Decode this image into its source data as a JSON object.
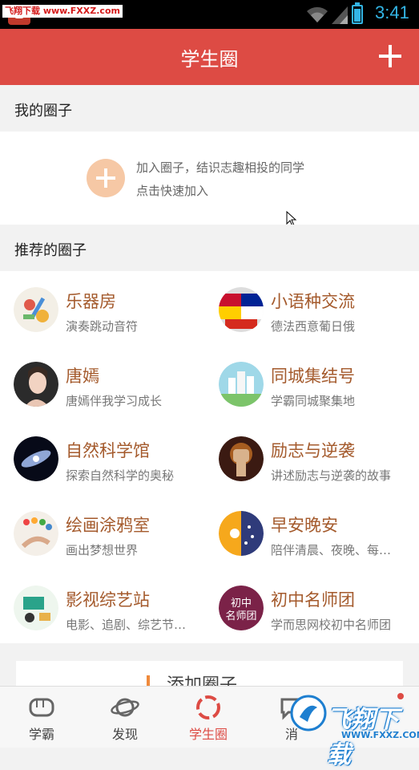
{
  "statusbar": {
    "watermark": "飞翔下载 www.FXXZ.com",
    "time": "3:41"
  },
  "header": {
    "title": "学生圈",
    "add_icon": "plus-icon"
  },
  "my_circles": {
    "heading": "我的圈子",
    "join_line1": "加入圈子，结识志趣相投的同学",
    "join_line2": "点击快速加入"
  },
  "recommended": {
    "heading": "推荐的圈子",
    "items": [
      {
        "name": "乐器房",
        "desc": "演奏跳动音符"
      },
      {
        "name": "小语种交流",
        "desc": "德法西意葡日俄"
      },
      {
        "name": "唐嫣",
        "desc": "唐嫣伴我学习成长"
      },
      {
        "name": "同城集结号",
        "desc": "学霸同城聚集地"
      },
      {
        "name": "自然科学馆",
        "desc": "探索自然科学的奥秘"
      },
      {
        "name": "励志与逆袭",
        "desc": "讲述励志与逆袭的故事"
      },
      {
        "name": "绘画涂鸦室",
        "desc": "画出梦想世界"
      },
      {
        "name": "早安晚安",
        "desc": "陪伴清晨、夜晚、每…"
      },
      {
        "name": "影视综艺站",
        "desc": "电影、追剧、综艺节…"
      },
      {
        "name": "初中名师团",
        "desc": "学而思网校初中名师团"
      }
    ]
  },
  "add_card": {
    "label": "添加圈子"
  },
  "nav": {
    "tabs": [
      {
        "label": "学霸"
      },
      {
        "label": "发现"
      },
      {
        "label": "学生圈"
      },
      {
        "label": "消"
      }
    ]
  },
  "watermark": {
    "text": "飞翔下载",
    "url": "WWW.FXXZ.COM"
  },
  "colors": {
    "accent": "#dd4b44",
    "name": "#a45a2c"
  }
}
